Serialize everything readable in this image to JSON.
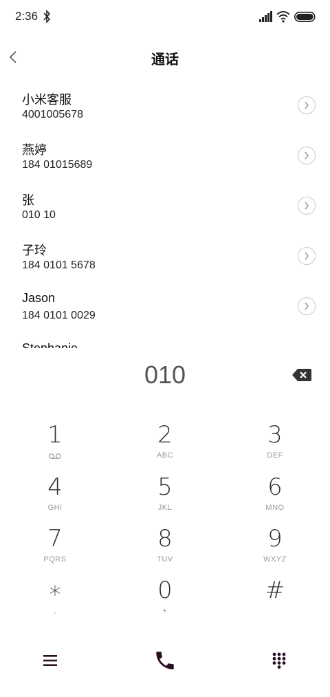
{
  "status_bar": {
    "time": "2:36",
    "icons": [
      "bluetooth-icon",
      "signal-icon",
      "wifi-icon",
      "battery-icon"
    ]
  },
  "header": {
    "title": "通话",
    "back_icon": "chevron-left-icon"
  },
  "contacts": [
    {
      "name": "小米客服",
      "number": "4001005678"
    },
    {
      "name": "燕婷",
      "number": "184 01015689"
    },
    {
      "name": "张",
      "number": "010 10"
    },
    {
      "name": "子玲",
      "number": "184 0101 5678"
    },
    {
      "name": "Jason",
      "number": "184 0101 0029"
    },
    {
      "name": "Stephanie",
      "number": ""
    }
  ],
  "dialer": {
    "input_value": "010",
    "backspace_icon": "backspace-icon"
  },
  "keypad": [
    {
      "digit": "1",
      "letters": "",
      "sub_icon": "voicemail-icon"
    },
    {
      "digit": "2",
      "letters": "ABC"
    },
    {
      "digit": "3",
      "letters": "DEF"
    },
    {
      "digit": "4",
      "letters": "GHI"
    },
    {
      "digit": "5",
      "letters": "JKL"
    },
    {
      "digit": "6",
      "letters": "MNO"
    },
    {
      "digit": "7",
      "letters": "PQRS"
    },
    {
      "digit": "8",
      "letters": "TUV"
    },
    {
      "digit": "9",
      "letters": "WXYZ"
    },
    {
      "digit": "∗",
      "letters": ","
    },
    {
      "digit": "0",
      "letters": "+"
    },
    {
      "digit": "#",
      "letters": ""
    }
  ],
  "bottom_bar": {
    "left_icon": "menu-icon",
    "center_icon": "phone-call-icon",
    "right_icon": "dialpad-icon"
  },
  "colors": {
    "text": "#111111",
    "secondary": "#9a9a9a",
    "accent_dark": "#2a0f24"
  }
}
